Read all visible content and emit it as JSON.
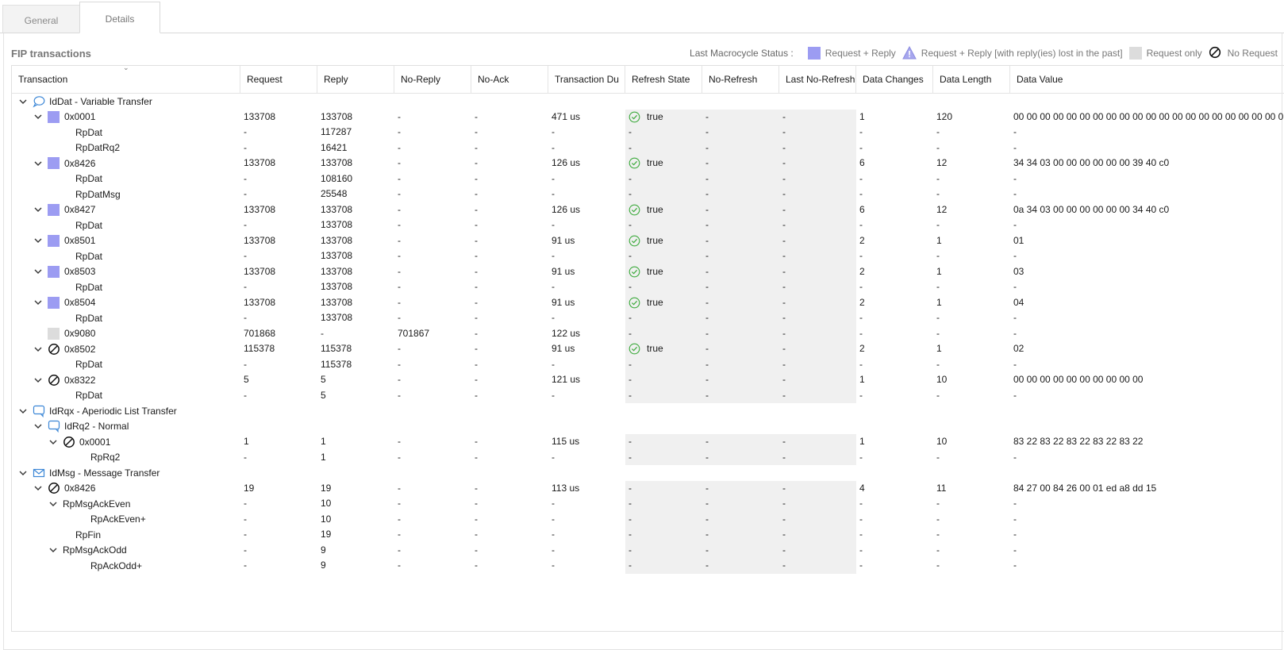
{
  "tabs": [
    {
      "label": "General"
    },
    {
      "label": "Details"
    }
  ],
  "section_title": "FIP transactions",
  "legend": {
    "title": "Last Macrocycle Status :",
    "items": [
      {
        "label": "Request + Reply",
        "icon": "request-reply-square",
        "color": "#9c9cf2"
      },
      {
        "label": "Request + Reply [with reply(ies) lost in the past]",
        "icon": "warning-triangle"
      },
      {
        "label": "Request only",
        "icon": "request-only-square",
        "color": "#dcdcdc"
      },
      {
        "label": "No Request",
        "icon": "no-request-icon"
      }
    ]
  },
  "columns": [
    "Transaction",
    "Request",
    "Reply",
    "No-Reply",
    "No-Ack",
    "Transaction Du",
    "Refresh State",
    "No-Refresh",
    "Last No-Refresh",
    "Data Changes",
    "Data Length",
    "Data Value"
  ],
  "rows": [
    {
      "level": 0,
      "expander": true,
      "icon": "variable-bubble-icon",
      "name": "IdDat - Variable Transfer",
      "group": true
    },
    {
      "level": 1,
      "expander": true,
      "icon": "request-reply-square",
      "name": "0x0001",
      "request": "133708",
      "reply": "133708",
      "noreply": "-",
      "noack": "-",
      "duration": "471 us",
      "refresh": "true",
      "refresh_ok": true,
      "norefresh": "-",
      "lastnorefresh": "-",
      "changes": "1",
      "length": "120",
      "value": "00 00 00 00 00 00 00 00 00 00 00 00 00 00 00 00 00 00 00 00 00 00 ..."
    },
    {
      "level": 2,
      "name": "RpDat",
      "request": "-",
      "reply": "117287",
      "noreply": "-",
      "noack": "-",
      "duration": "-",
      "refresh": "-",
      "norefresh": "-",
      "lastnorefresh": "-",
      "changes": "-",
      "length": "-",
      "value": "-"
    },
    {
      "level": 2,
      "name": "RpDatRq2",
      "request": "-",
      "reply": "16421",
      "noreply": "-",
      "noack": "-",
      "duration": "-",
      "refresh": "-",
      "norefresh": "-",
      "lastnorefresh": "-",
      "changes": "-",
      "length": "-",
      "value": "-"
    },
    {
      "level": 1,
      "expander": true,
      "icon": "request-reply-square",
      "name": "0x8426",
      "request": "133708",
      "reply": "133708",
      "noreply": "-",
      "noack": "-",
      "duration": "126 us",
      "refresh": "true",
      "refresh_ok": true,
      "norefresh": "-",
      "lastnorefresh": "-",
      "changes": "6",
      "length": "12",
      "value": "34 34 03 00 00 00 00 00 00 39 40 c0"
    },
    {
      "level": 2,
      "name": "RpDat",
      "request": "-",
      "reply": "108160",
      "noreply": "-",
      "noack": "-",
      "duration": "-",
      "refresh": "-",
      "norefresh": "-",
      "lastnorefresh": "-",
      "changes": "-",
      "length": "-",
      "value": "-"
    },
    {
      "level": 2,
      "name": "RpDatMsg",
      "request": "-",
      "reply": "25548",
      "noreply": "-",
      "noack": "-",
      "duration": "-",
      "refresh": "-",
      "norefresh": "-",
      "lastnorefresh": "-",
      "changes": "-",
      "length": "-",
      "value": "-"
    },
    {
      "level": 1,
      "expander": true,
      "icon": "request-reply-square",
      "name": "0x8427",
      "request": "133708",
      "reply": "133708",
      "noreply": "-",
      "noack": "-",
      "duration": "126 us",
      "refresh": "true",
      "refresh_ok": true,
      "norefresh": "-",
      "lastnorefresh": "-",
      "changes": "6",
      "length": "12",
      "value": "0a 34 03 00 00 00 00 00 00 34 40 c0"
    },
    {
      "level": 2,
      "name": "RpDat",
      "request": "-",
      "reply": "133708",
      "noreply": "-",
      "noack": "-",
      "duration": "-",
      "refresh": "-",
      "norefresh": "-",
      "lastnorefresh": "-",
      "changes": "-",
      "length": "-",
      "value": "-"
    },
    {
      "level": 1,
      "expander": true,
      "icon": "request-reply-square",
      "name": "0x8501",
      "request": "133708",
      "reply": "133708",
      "noreply": "-",
      "noack": "-",
      "duration": "91 us",
      "refresh": "true",
      "refresh_ok": true,
      "norefresh": "-",
      "lastnorefresh": "-",
      "changes": "2",
      "length": "1",
      "value": "01"
    },
    {
      "level": 2,
      "name": "RpDat",
      "request": "-",
      "reply": "133708",
      "noreply": "-",
      "noack": "-",
      "duration": "-",
      "refresh": "-",
      "norefresh": "-",
      "lastnorefresh": "-",
      "changes": "-",
      "length": "-",
      "value": "-"
    },
    {
      "level": 1,
      "expander": true,
      "icon": "request-reply-square",
      "name": "0x8503",
      "request": "133708",
      "reply": "133708",
      "noreply": "-",
      "noack": "-",
      "duration": "91 us",
      "refresh": "true",
      "refresh_ok": true,
      "norefresh": "-",
      "lastnorefresh": "-",
      "changes": "2",
      "length": "1",
      "value": "03"
    },
    {
      "level": 2,
      "name": "RpDat",
      "request": "-",
      "reply": "133708",
      "noreply": "-",
      "noack": "-",
      "duration": "-",
      "refresh": "-",
      "norefresh": "-",
      "lastnorefresh": "-",
      "changes": "-",
      "length": "-",
      "value": "-"
    },
    {
      "level": 1,
      "expander": true,
      "icon": "request-reply-square",
      "name": "0x8504",
      "request": "133708",
      "reply": "133708",
      "noreply": "-",
      "noack": "-",
      "duration": "91 us",
      "refresh": "true",
      "refresh_ok": true,
      "norefresh": "-",
      "lastnorefresh": "-",
      "changes": "2",
      "length": "1",
      "value": "04"
    },
    {
      "level": 2,
      "name": "RpDat",
      "request": "-",
      "reply": "133708",
      "noreply": "-",
      "noack": "-",
      "duration": "-",
      "refresh": "-",
      "norefresh": "-",
      "lastnorefresh": "-",
      "changes": "-",
      "length": "-",
      "value": "-"
    },
    {
      "level": 1,
      "expander": false,
      "icon": "request-only-square",
      "name": "0x9080",
      "request": "701868",
      "reply": "-",
      "noreply": "701867",
      "noack": "-",
      "duration": "122 us",
      "refresh": "-",
      "norefresh": "-",
      "lastnorefresh": "-",
      "changes": "-",
      "length": "-",
      "value": "-"
    },
    {
      "level": 1,
      "expander": true,
      "icon": "no-request-icon",
      "name": "0x8502",
      "request": "115378",
      "reply": "115378",
      "noreply": "-",
      "noack": "-",
      "duration": "91 us",
      "refresh": "true",
      "refresh_ok": true,
      "norefresh": "-",
      "lastnorefresh": "-",
      "changes": "2",
      "length": "1",
      "value": "02"
    },
    {
      "level": 2,
      "name": "RpDat",
      "request": "-",
      "reply": "115378",
      "noreply": "-",
      "noack": "-",
      "duration": "-",
      "refresh": "-",
      "norefresh": "-",
      "lastnorefresh": "-",
      "changes": "-",
      "length": "-",
      "value": "-"
    },
    {
      "level": 1,
      "expander": true,
      "icon": "no-request-icon",
      "name": "0x8322",
      "request": "5",
      "reply": "5",
      "noreply": "-",
      "noack": "-",
      "duration": "121 us",
      "refresh": "-",
      "norefresh": "-",
      "lastnorefresh": "-",
      "changes": "1",
      "length": "10",
      "value": "00 00 00 00 00 00 00 00 00 00"
    },
    {
      "level": 2,
      "name": "RpDat",
      "request": "-",
      "reply": "5",
      "noreply": "-",
      "noack": "-",
      "duration": "-",
      "refresh": "-",
      "norefresh": "-",
      "lastnorefresh": "-",
      "changes": "-",
      "length": "-",
      "value": "-"
    },
    {
      "level": 0,
      "expander": true,
      "icon": "list-bubble-icon",
      "name": "IdRqx - Aperiodic List Transfer",
      "group": true
    },
    {
      "level": 1,
      "expander": true,
      "icon": "list-bubble-icon",
      "name": "IdRq2 - Normal",
      "group": true
    },
    {
      "level": 2,
      "expander": true,
      "icon": "no-request-icon",
      "name": "0x0001",
      "request": "1",
      "reply": "1",
      "noreply": "-",
      "noack": "-",
      "duration": "115 us",
      "refresh": "-",
      "norefresh": "-",
      "lastnorefresh": "-",
      "changes": "1",
      "length": "10",
      "value": "83 22 83 22 83 22 83 22 83 22"
    },
    {
      "level": 3,
      "name": "RpRq2",
      "request": "-",
      "reply": "1",
      "noreply": "-",
      "noack": "-",
      "duration": "-",
      "refresh": "-",
      "norefresh": "-",
      "lastnorefresh": "-",
      "changes": "-",
      "length": "-",
      "value": "-"
    },
    {
      "level": 0,
      "expander": true,
      "icon": "message-envelope-icon",
      "name": "IdMsg - Message Transfer",
      "group": true
    },
    {
      "level": 1,
      "expander": true,
      "icon": "no-request-icon",
      "name": "0x8426",
      "request": "19",
      "reply": "19",
      "noreply": "-",
      "noack": "-",
      "duration": "113 us",
      "refresh": "-",
      "norefresh": "-",
      "lastnorefresh": "-",
      "changes": "4",
      "length": "11",
      "value": "84 27 00 84 26 00 01 ed a8 dd 15"
    },
    {
      "level": 2,
      "expander": true,
      "name": "RpMsgAckEven",
      "request": "-",
      "reply": "10",
      "noreply": "-",
      "noack": "-",
      "duration": "-",
      "refresh": "-",
      "norefresh": "-",
      "lastnorefresh": "-",
      "changes": "-",
      "length": "-",
      "value": "-"
    },
    {
      "level": 3,
      "name": "RpAckEven+",
      "request": "-",
      "reply": "10",
      "noreply": "-",
      "noack": "-",
      "duration": "-",
      "refresh": "-",
      "norefresh": "-",
      "lastnorefresh": "-",
      "changes": "-",
      "length": "-",
      "value": "-"
    },
    {
      "level": 2,
      "name": "RpFin",
      "request": "-",
      "reply": "19",
      "noreply": "-",
      "noack": "-",
      "duration": "-",
      "refresh": "-",
      "norefresh": "-",
      "lastnorefresh": "-",
      "changes": "-",
      "length": "-",
      "value": "-"
    },
    {
      "level": 2,
      "expander": true,
      "name": "RpMsgAckOdd",
      "request": "-",
      "reply": "9",
      "noreply": "-",
      "noack": "-",
      "duration": "-",
      "refresh": "-",
      "norefresh": "-",
      "lastnorefresh": "-",
      "changes": "-",
      "length": "-",
      "value": "-"
    },
    {
      "level": 3,
      "name": "RpAckOdd+",
      "request": "-",
      "reply": "9",
      "noreply": "-",
      "noack": "-",
      "duration": "-",
      "refresh": "-",
      "norefresh": "-",
      "lastnorefresh": "-",
      "changes": "-",
      "length": "-",
      "value": "-"
    }
  ]
}
